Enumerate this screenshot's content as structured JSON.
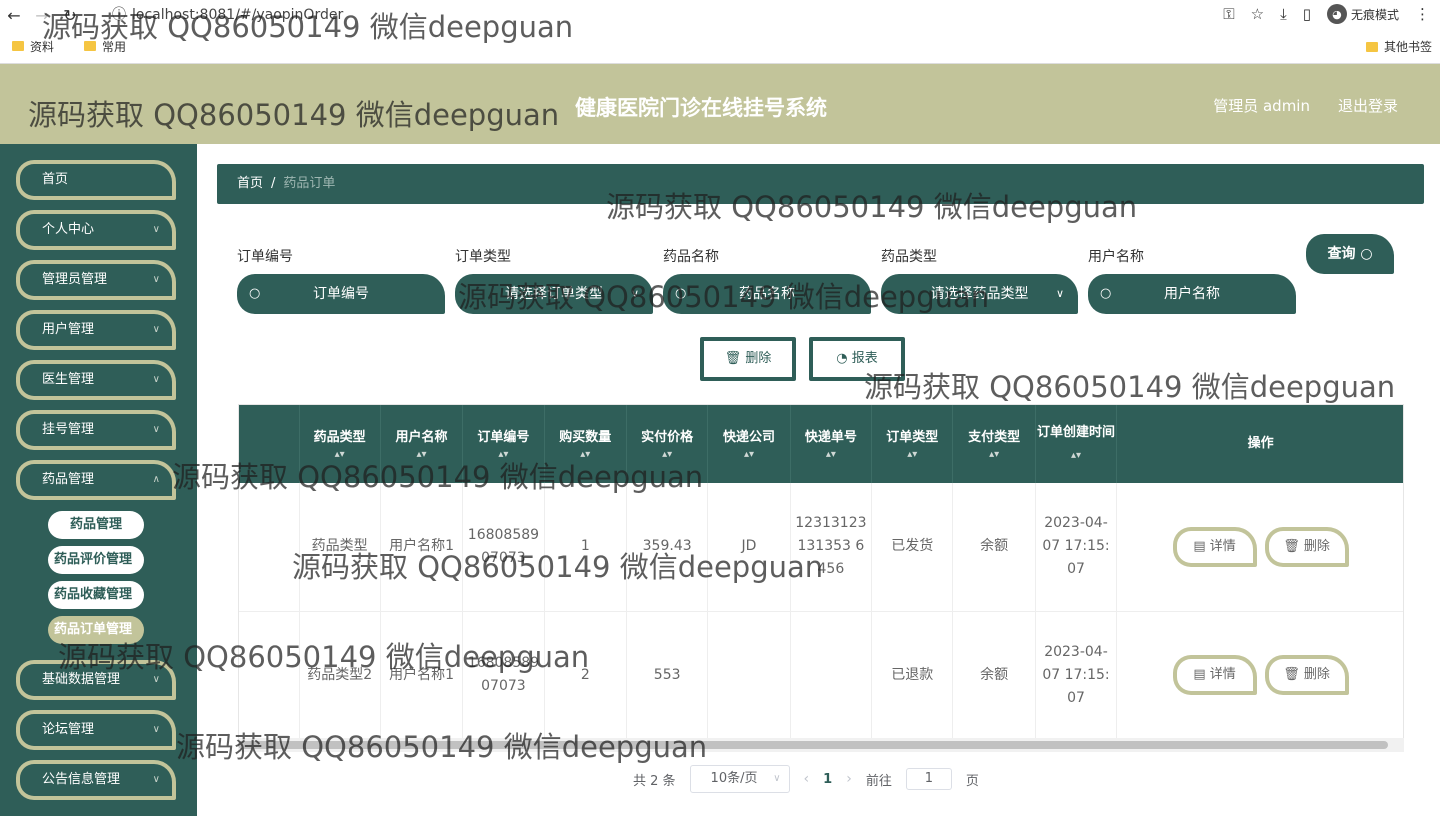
{
  "browser": {
    "url": "localhost:8081/#/yaopinOrder",
    "bookmarks": [
      "资料",
      "常用"
    ],
    "other_bookmarks": "其他书签",
    "incognito_label": "无痕模式"
  },
  "header": {
    "system_title": "健康医院门诊在线挂号系统",
    "user_label": "管理员 admin",
    "logout_label": "退出登录"
  },
  "sidebar": {
    "items": [
      "首页",
      "个人中心",
      "管理员管理",
      "用户管理",
      "医生管理",
      "挂号管理",
      "药品管理"
    ],
    "sub_items": [
      "药品管理",
      "药品评价管理",
      "药品收藏管理",
      "药品订单管理"
    ],
    "items_after": [
      "基础数据管理",
      "论坛管理",
      "公告信息管理"
    ]
  },
  "breadcrumb": {
    "home": "首页",
    "current": "药品订单"
  },
  "search": {
    "order_no_label": "订单编号",
    "order_no_placeholder": "订单编号",
    "order_type_label": "订单类型",
    "order_type_placeholder": "请选择订单类型",
    "drug_name_label": "药品名称",
    "drug_name_placeholder": "药品名称",
    "drug_type_label": "药品类型",
    "drug_type_placeholder": "请选择药品类型",
    "user_name_label": "用户名称",
    "user_name_placeholder": "用户名称",
    "query_button": "查询"
  },
  "actions": {
    "delete": "删除",
    "report": "报表"
  },
  "table": {
    "columns": [
      "药品类型",
      "用户名称",
      "订单编号",
      "购买数量",
      "实付价格",
      "快递公司",
      "快递单号",
      "订单类型",
      "支付类型",
      "订单创建时间",
      "操作"
    ],
    "rows": [
      [
        "药品类型",
        "用户名称1",
        "1680858907073",
        "1",
        "359.43",
        "JD",
        "12313123131353 6456",
        "已发货",
        "余额",
        "2023-04-07 17:15:07"
      ],
      [
        "药品类型2",
        "用户名称1",
        "1680858907073",
        "2",
        "553",
        "",
        "",
        "已退款",
        "余额",
        "2023-04-07 17:15:07"
      ]
    ],
    "detail_button": "详情",
    "delete_button": "删除"
  },
  "pager": {
    "total": "共 2 条",
    "page_size": "10条/页",
    "current_page": "1",
    "goto_label": "前往",
    "goto_value": "1",
    "page_suffix": "页"
  },
  "watermark": "源码获取 QQ86050149 微信deepguan",
  "colors": {
    "primary": "#2f5e58",
    "accent": "#c2c49a"
  }
}
